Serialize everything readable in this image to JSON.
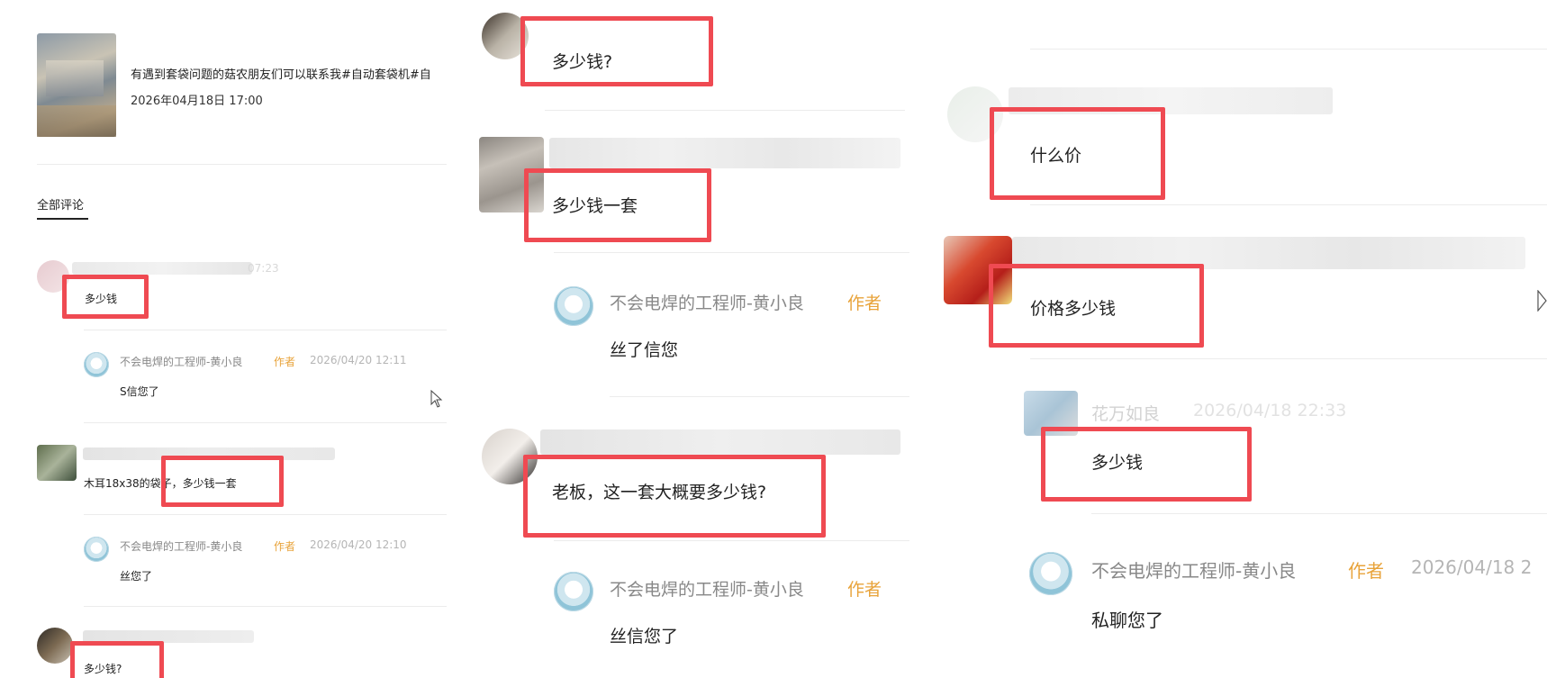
{
  "left": {
    "post_title": "有遇到套袋问题的菇农朋友们可以联系我#自动套袋机#自",
    "post_date": "2026年04月18日 17:00",
    "tab_all_comments": "全部评论",
    "blur_time_fragment": "07:23",
    "c1_text": "多少钱",
    "r1_name": "不会电焊的工程师-黄小良",
    "r1_tag": "作者",
    "r1_time": "2026/04/20 12:11",
    "r1_text": "S信您了",
    "c2_text": "木耳18x38的袋子，多少钱一套",
    "r2_name": "不会电焊的工程师-黄小良",
    "r2_tag": "作者",
    "r2_time": "2026/04/20 12:10",
    "r2_text": "丝您了",
    "c3_text": "多少钱?"
  },
  "middle": {
    "c1_text": "多少钱?",
    "c2_text": "多少钱一套",
    "r1_name": "不会电焊的工程师-黄小良",
    "r1_tag": "作者",
    "r1_text": "丝了信您",
    "c3_text": "老板，这一套大概要多少钱?",
    "r2_name": "不会电焊的工程师-黄小良",
    "r2_tag": "作者",
    "r2_text": "丝信您了"
  },
  "right": {
    "c1_text": "什么价",
    "c2_text": "价格多少钱",
    "blur_reply_name": "花万如良",
    "blur_reply_time": "2026/04/18 22:33",
    "c3_text": "多少钱",
    "r1_name": "不会电焊的工程师-黄小良",
    "r1_tag": "作者",
    "r1_time": "2026/04/18 2",
    "r1_text": "私聊您了"
  },
  "colors": {
    "highlight": "#ef4a52",
    "author_tag": "#e8a33a"
  }
}
